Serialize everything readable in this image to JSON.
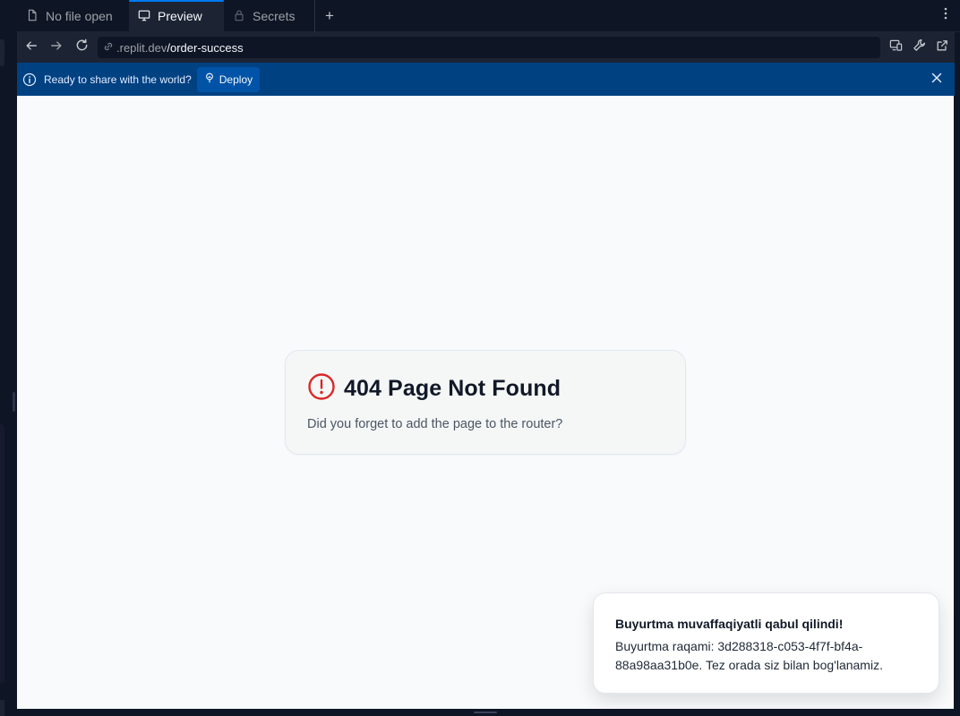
{
  "tabs": [
    {
      "label": "No file open",
      "icon": "file-icon",
      "active": false
    },
    {
      "label": "Preview",
      "icon": "monitor-icon",
      "active": true
    },
    {
      "label": "Secrets",
      "icon": "lock-icon",
      "active": false
    }
  ],
  "tab_add_label": "+",
  "urlbar": {
    "host": ".replit.dev",
    "path": "/order-success"
  },
  "banner": {
    "message": "Ready to share with the world?",
    "deploy_label": "Deploy"
  },
  "page": {
    "error_title": "404 Page Not Found",
    "error_subtitle": "Did you forget to add the page to the router?"
  },
  "toast": {
    "title": "Buyurtma muvaffaqiyatli qabul qilindi!",
    "description": "Buyurtma raqami: 3d288318-c053-4f7f-bf4a-88a98aa31b0e. Tez orada siz bilan bog'lanamiz."
  },
  "colors": {
    "banner_bg": "#004182",
    "accent": "#0079f2",
    "error_icon": "#dc2626"
  }
}
